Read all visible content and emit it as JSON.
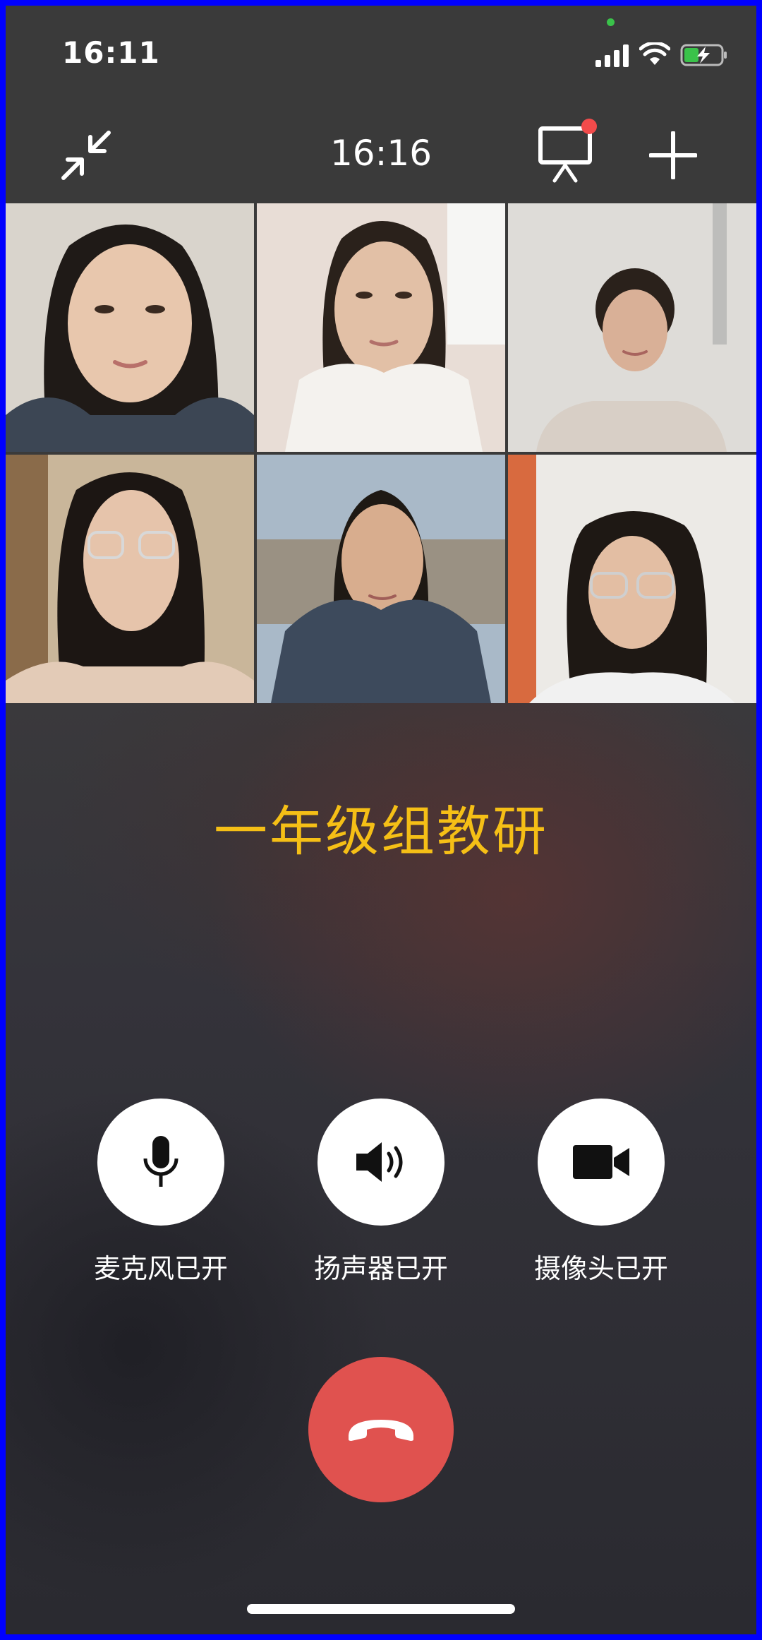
{
  "status_bar": {
    "time": "16:11",
    "icons": [
      "signal-icon",
      "wifi-icon",
      "battery-charging-icon"
    ]
  },
  "header": {
    "call_timer": "16:16",
    "icons": [
      "minimize-icon",
      "screen-share-icon",
      "add-icon"
    ],
    "notification_color": "#f24b4b"
  },
  "participants": [
    {
      "tile": "participant-1"
    },
    {
      "tile": "participant-2"
    },
    {
      "tile": "participant-3"
    },
    {
      "tile": "participant-4"
    },
    {
      "tile": "participant-5"
    },
    {
      "tile": "participant-6"
    }
  ],
  "group": {
    "title": "一年级组教研",
    "title_color": "#f5bf16"
  },
  "controls": {
    "mic": {
      "label": "麦克风已开",
      "icon": "microphone-icon"
    },
    "speaker": {
      "label": "扬声器已开",
      "icon": "speaker-icon"
    },
    "camera": {
      "label": "摄像头已开",
      "icon": "video-camera-icon"
    }
  },
  "hangup": {
    "icon": "hang-up-phone-icon",
    "color": "#e0524f"
  }
}
